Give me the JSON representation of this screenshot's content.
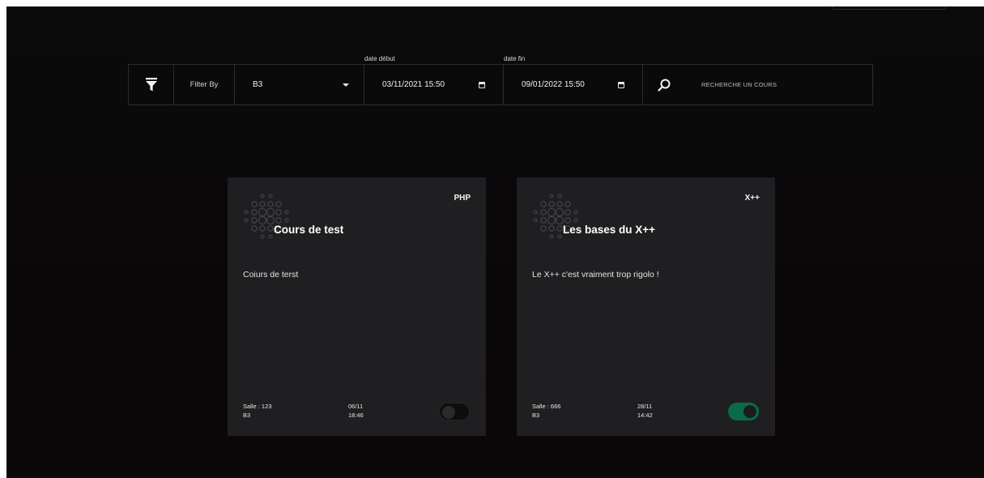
{
  "filter": {
    "filter_by_label": "Filter By",
    "selected_group": "B3",
    "date_start_label": "date début",
    "date_start_value": "03/11/2021 15:50",
    "date_end_label": "date fin",
    "date_end_value": "09/01/2022 15:50",
    "search_placeholder": "RECHERCHE UN COURS"
  },
  "icons": {
    "filter": "filter-funnel-icon",
    "dropdown": "caret-down-icon",
    "calendar": "calendar-icon",
    "search": "magnifier-icon",
    "card_decoration": "dot-pattern-icon"
  },
  "colors": {
    "background": "#0b0b0c",
    "card": "#1f1f21",
    "toggle_on": "#0b6b49",
    "toggle_off": "#0d0d0d"
  },
  "courses": [
    {
      "tag": "PHP",
      "title": "Cours de test",
      "description": "Coiurs de terst",
      "room": "Salle : 123",
      "group": "B3",
      "date": "06/11",
      "time": "18:46",
      "active": false
    },
    {
      "tag": "X++",
      "title": "Les bases du X++",
      "description": "Le X++ c'est vraiment trop rigolo !",
      "room": "Salle : 666",
      "group": "B3",
      "date": "28/11",
      "time": "14:42",
      "active": true
    }
  ]
}
